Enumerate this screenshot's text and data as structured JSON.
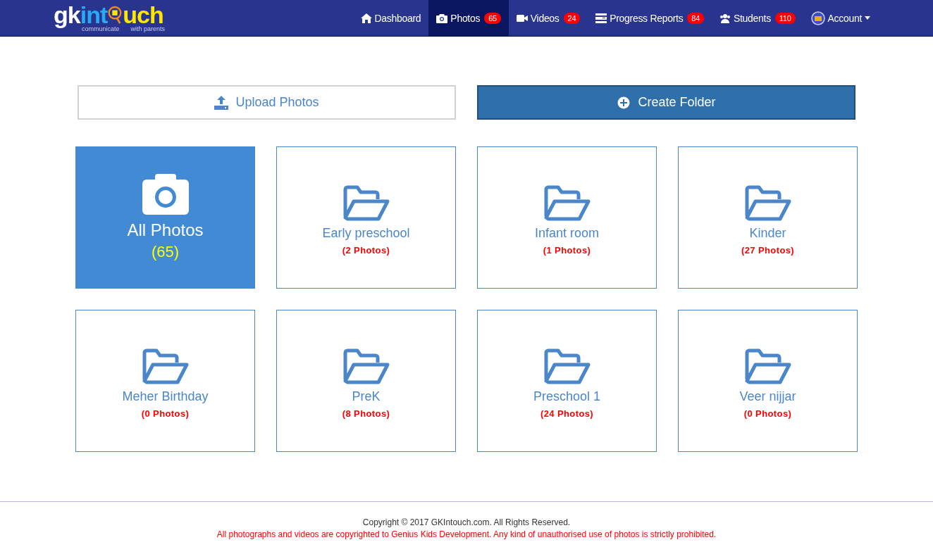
{
  "logo": {
    "part_1": "gk",
    "part_2": "int",
    "part_3": "uch",
    "tagline_1": "communicate",
    "tagline_2": "with parents"
  },
  "nav": [
    {
      "label": "Dashboard",
      "kind": "home",
      "selected": false
    },
    {
      "label": "Photos",
      "kind": "camera",
      "badge": "65",
      "selected": true
    },
    {
      "label": "Videos",
      "kind": "video",
      "badge": "24",
      "selected": false
    },
    {
      "label": "Progress Reports",
      "kind": "report",
      "badge": "84",
      "selected": false
    },
    {
      "label": "Students",
      "kind": "users",
      "badge": "110",
      "selected": false
    },
    {
      "label": "Account",
      "kind": "avatar",
      "dropdown": true,
      "selected": false
    }
  ],
  "actions": [
    {
      "label": "Upload Photos",
      "kind": "upload"
    },
    {
      "label": "Create Folder",
      "kind": "create"
    }
  ],
  "folders": [
    {
      "kind": "all",
      "name": "All Photos",
      "count": "(65)"
    },
    {
      "kind": "folder",
      "name": "Early preschool",
      "count": "(2 Photos)"
    },
    {
      "kind": "folder",
      "name": "Infant room",
      "count": "(1 Photos)"
    },
    {
      "kind": "folder",
      "name": "Kinder",
      "count": "(27 Photos)"
    },
    {
      "kind": "folder",
      "name": "Meher Birthday",
      "count": "(0 Photos)"
    },
    {
      "kind": "folder",
      "name": "PreK",
      "count": "(8 Photos)"
    },
    {
      "kind": "folder",
      "name": "Preschool 1",
      "count": "(24 Photos)"
    },
    {
      "kind": "folder",
      "name": "Veer nijjar",
      "count": "(0 Photos)"
    }
  ],
  "footer": {
    "copyright": "Copyright © 2017 GKIntouch.com. All Rights Reserved.",
    "notice": "All photographs and videos are copyrighted to Genius Kids Development. Any kind of unauthorised use of photos is strictly prohibited."
  }
}
